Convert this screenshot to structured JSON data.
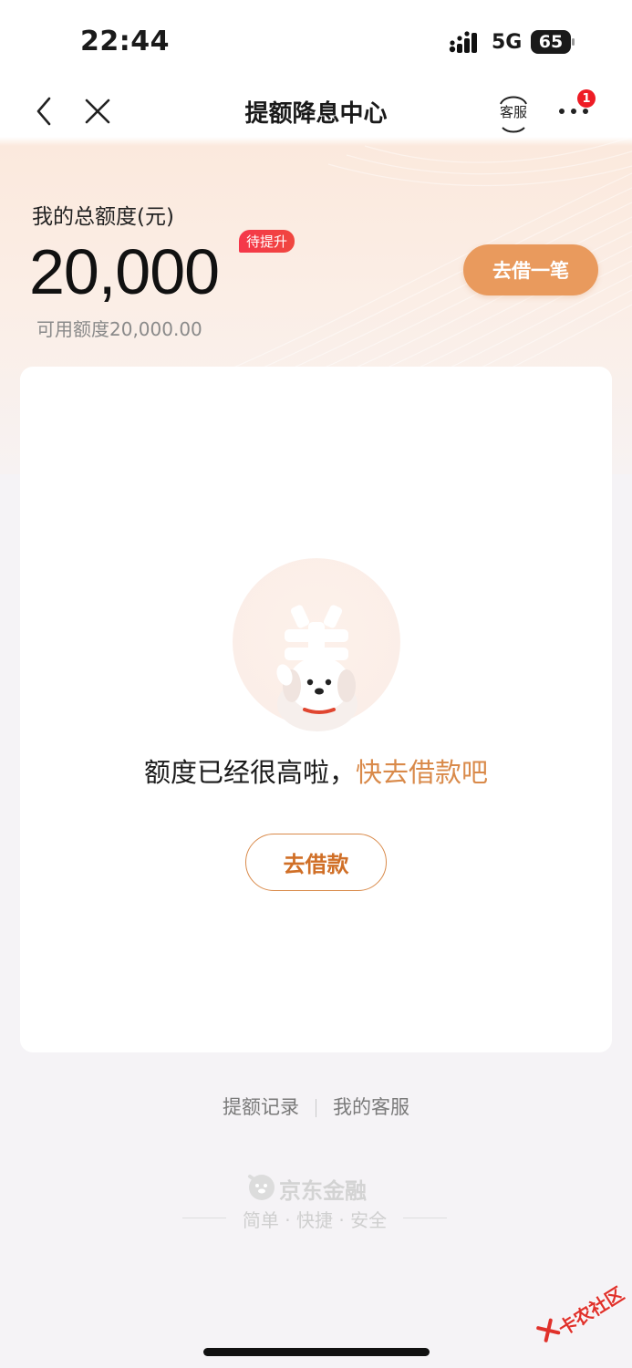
{
  "status_bar": {
    "time": "22:44",
    "network": "5G",
    "battery": "65"
  },
  "nav": {
    "title": "提额降息中心",
    "service_label": "客服",
    "badge_count": "1"
  },
  "credit": {
    "label": "我的总额度(元)",
    "amount": "20,000",
    "tag": "待提升",
    "available": "可用额度20,000.00",
    "borrow_button": "去借一笔"
  },
  "card": {
    "message_prefix": "额度已经很高啦，",
    "message_highlight": "快去借款吧",
    "loan_button": "去借款"
  },
  "footer": {
    "links": [
      "提额记录",
      "我的客服"
    ],
    "brand_name": "京东金融",
    "slogan": "简单 · 快捷 · 安全"
  },
  "watermark": {
    "text": "卡农社区"
  },
  "colors": {
    "accent": "#e99a5d",
    "accent_text": "#d98a4a",
    "badge": "#ee1c25"
  }
}
